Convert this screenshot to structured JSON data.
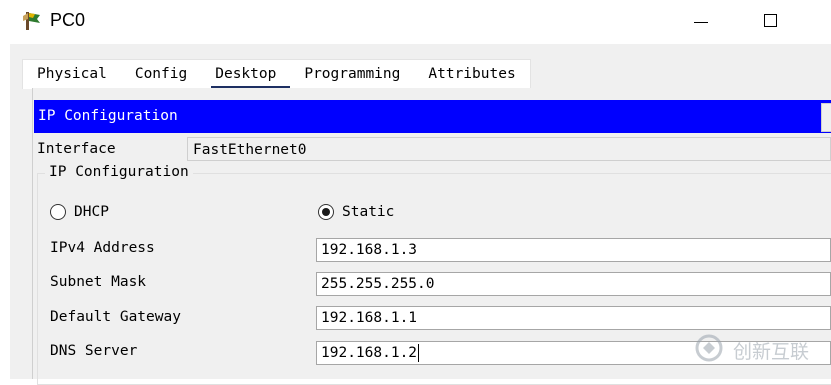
{
  "window": {
    "title": "PC0",
    "app_icon": "packet-tracer-pc-icon",
    "controls": [
      "minimize-icon",
      "maximize-icon"
    ]
  },
  "tabs": [
    {
      "label": "Physical",
      "active": false
    },
    {
      "label": "Config",
      "active": false
    },
    {
      "label": "Desktop",
      "active": true
    },
    {
      "label": "Programming",
      "active": false
    },
    {
      "label": "Attributes",
      "active": false
    }
  ],
  "panel": {
    "header": "IP Configuration",
    "header_color": "#0000ff",
    "interface_label": "Interface",
    "interface_value": "FastEthernet0",
    "group_title": "IP Configuration",
    "dhcp_label": "DHCP",
    "static_label": "Static",
    "mode": "Static",
    "fields": [
      {
        "label": "IPv4 Address",
        "value": "192.168.1.3"
      },
      {
        "label": "Subnet Mask",
        "value": "255.255.255.0"
      },
      {
        "label": "Default Gateway",
        "value": "192.168.1.1"
      },
      {
        "label": "DNS Server",
        "value": "192.168.1.2"
      }
    ]
  },
  "watermark": {
    "text": "创新互联",
    "icon": "chuangxin-logo-icon"
  }
}
